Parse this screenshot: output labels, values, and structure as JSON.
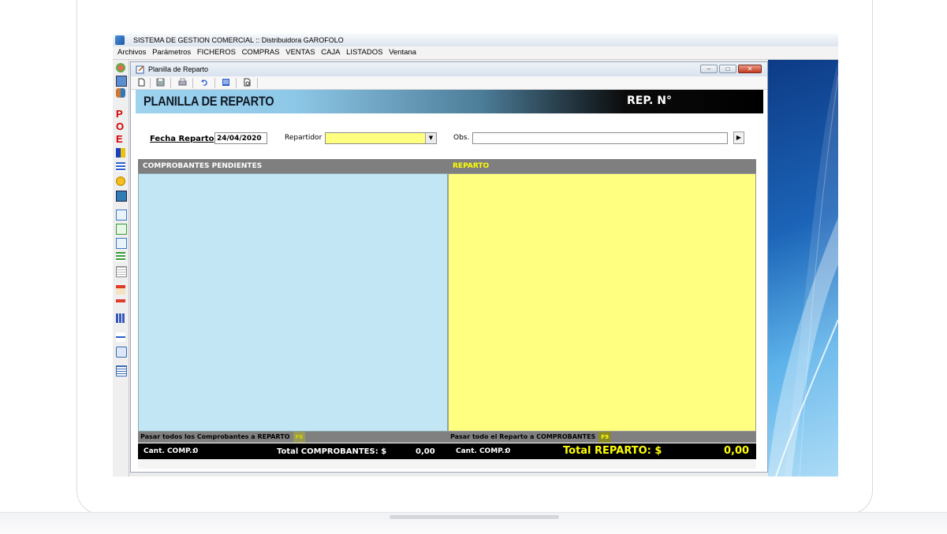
{
  "app": {
    "title": "SISTEMA DE GESTION COMERCIAL :: Distribuidora GAROFOLO"
  },
  "menu": [
    "Archivos",
    "Parámetros",
    "FICHEROS",
    "COMPRAS",
    "VENTAS",
    "CAJA",
    "LISTADOS",
    "Ventana"
  ],
  "side_toolbar_icons": [
    "products-icon",
    "contacts-icon",
    "users-icon",
    "p-icon",
    "o-icon",
    "e-icon",
    "f-icon",
    "list-icon",
    "coins-icon",
    "chart-icon",
    "form-icon",
    "form2-icon",
    "form3-icon",
    "list2-icon",
    "doc-icon",
    "calendar-icon",
    "calendar2-icon",
    "grid-icon",
    "minus-icon",
    "window-icon",
    "report-icon"
  ],
  "window": {
    "title": "Planilla de Reparto",
    "toolbar": [
      "new-icon",
      "save-icon",
      "print-icon",
      "undo-icon",
      "list-icon",
      "preview-icon"
    ]
  },
  "header": {
    "title": "PLANILLA DE REPARTO",
    "rep_no": "REP. N°"
  },
  "form": {
    "fecha_label": "Fecha Reparto",
    "fecha_value": "24/04/2020",
    "repartidor_label": "Repartidor",
    "repartidor_value": "",
    "obs_label": "Obs.",
    "obs_value": ""
  },
  "left_panel": {
    "header": "COMPROBANTES PENDIENTES",
    "footer_label": "Pasar todos los Comprobantes a REPARTO",
    "footer_key": "F8",
    "count_label": "Cant. COMP.:",
    "count_value": "0",
    "total_label": "Total COMPROBANTES: $",
    "total_value": "0,00"
  },
  "right_panel": {
    "header": "REPARTO",
    "footer_label": "Pasar todo el Reparto a COMPROBANTES",
    "footer_key": "F9",
    "count_label": "Cant. COMP.:",
    "count_value": "0",
    "total_label": "Total REPARTO: $",
    "total_value": "0,00"
  },
  "colors": {
    "pending_bg": "#c2e6f4",
    "reparto_bg": "#ffff80",
    "accent_yellow": "#ffff00"
  }
}
